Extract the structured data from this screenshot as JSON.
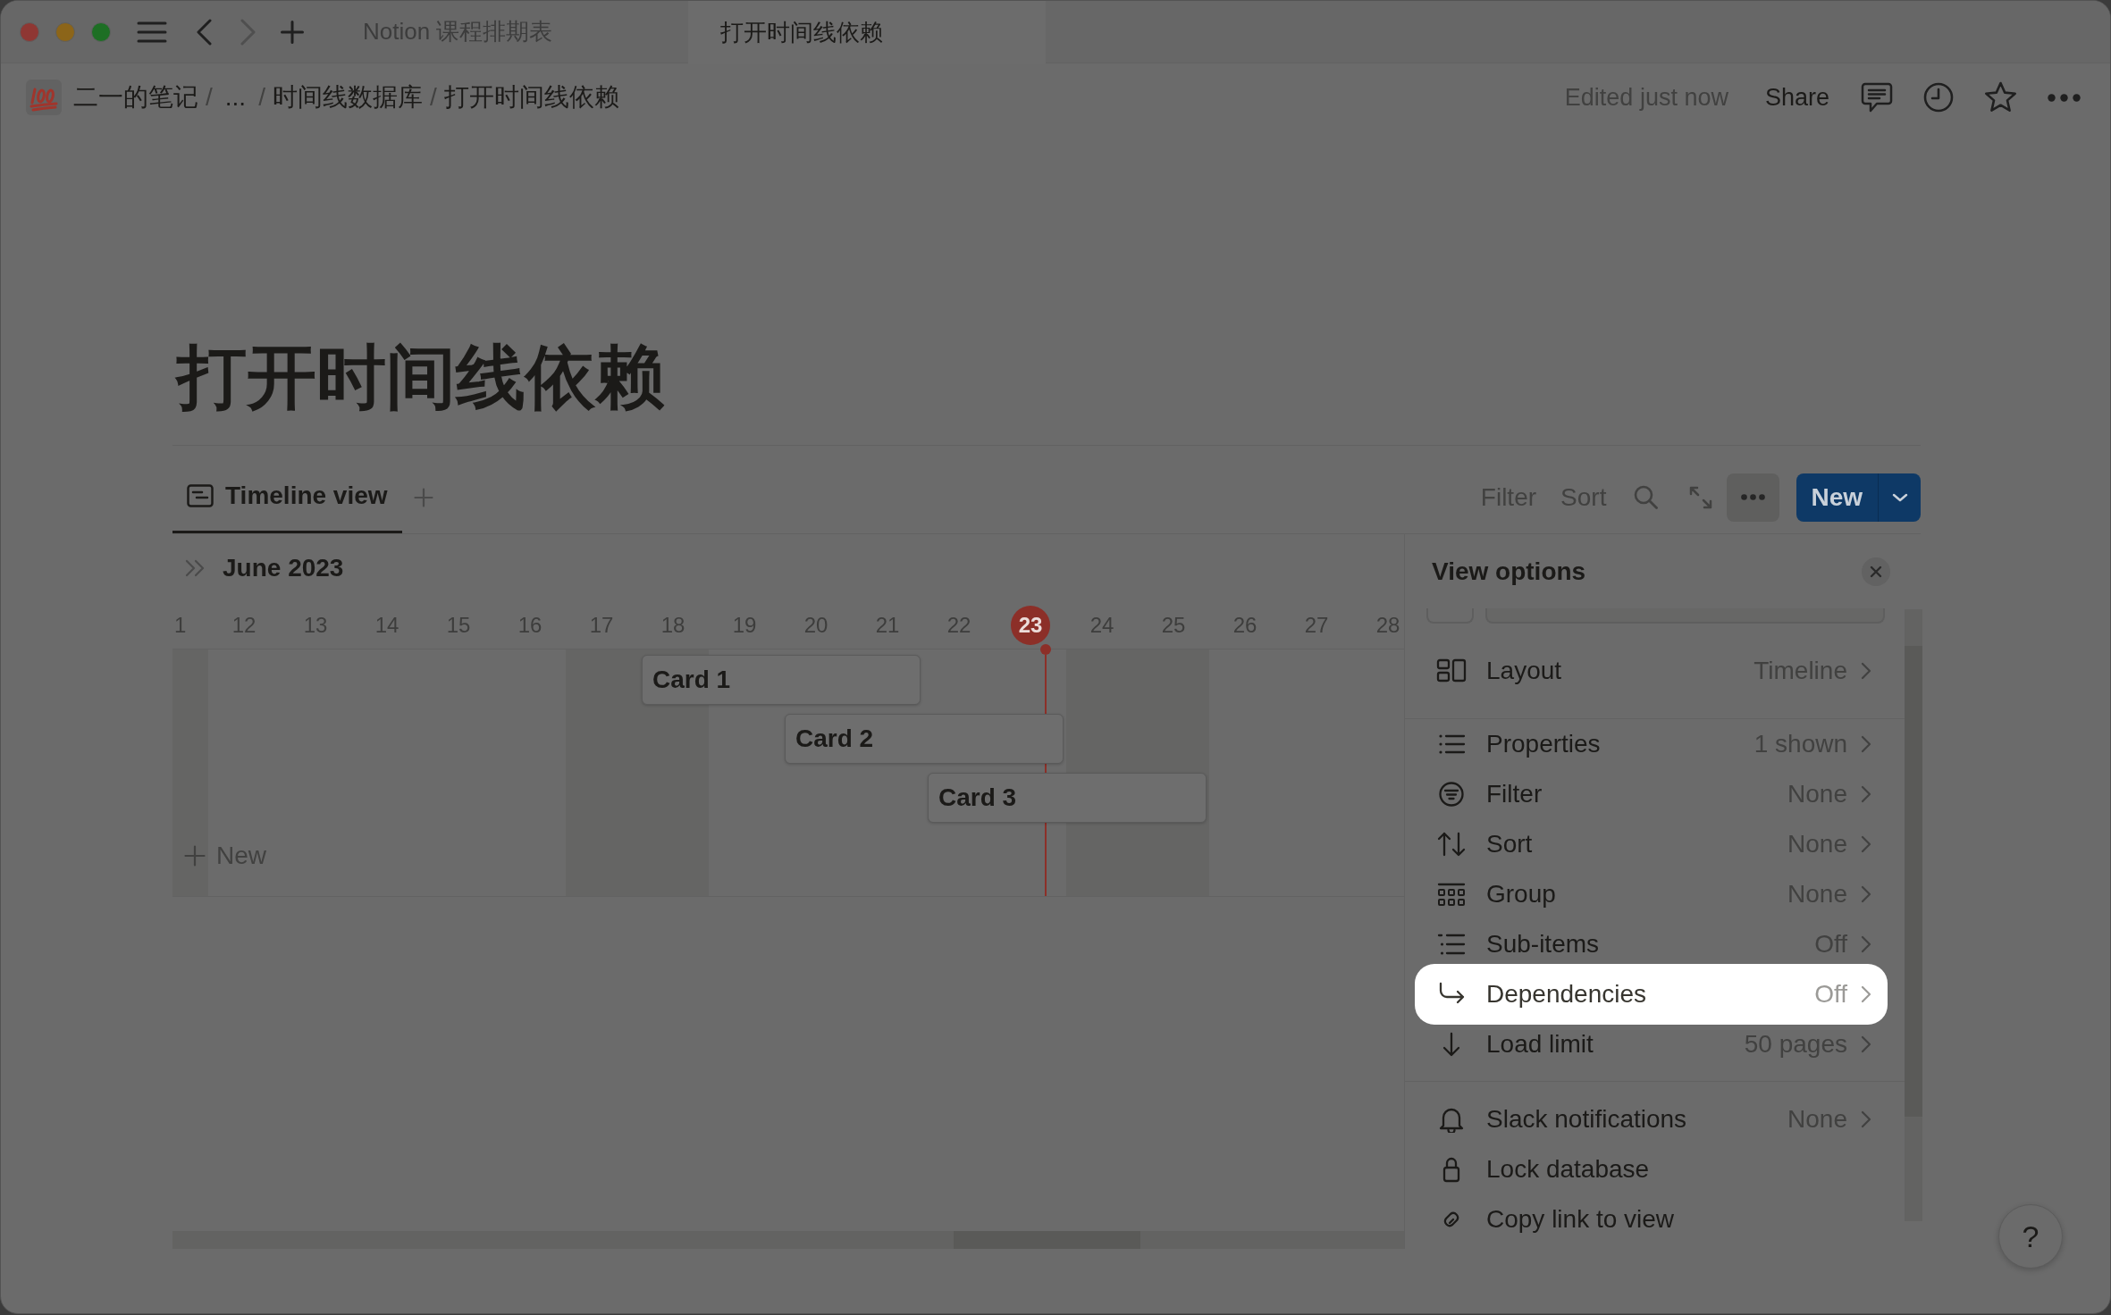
{
  "titlebar": {
    "back_disabled": false,
    "forward_disabled": true,
    "tabs": [
      {
        "title": "Notion 课程排期表",
        "selected": false
      },
      {
        "title": "打开时间线依赖",
        "selected": true
      }
    ]
  },
  "breadcrumb": {
    "separator": "/",
    "items": [
      "二一的笔记",
      "...",
      "时间线数据库",
      "打开时间线依赖"
    ]
  },
  "topbar": {
    "edited": "Edited just now",
    "share": "Share"
  },
  "page": {
    "title": "打开时间线依赖"
  },
  "view_tabs": [
    {
      "label": "Timeline view",
      "selected": true
    }
  ],
  "toolbar": {
    "filter": "Filter",
    "sort": "Sort",
    "more_active": true,
    "new": "New"
  },
  "timeline": {
    "month": "June 2023",
    "dates": [
      {
        "label": "1",
        "weekend": true,
        "today": false
      },
      {
        "label": "12",
        "weekend": false,
        "today": false
      },
      {
        "label": "13",
        "weekend": false,
        "today": false
      },
      {
        "label": "14",
        "weekend": false,
        "today": false
      },
      {
        "label": "15",
        "weekend": false,
        "today": false
      },
      {
        "label": "16",
        "weekend": false,
        "today": false
      },
      {
        "label": "17",
        "weekend": true,
        "today": false
      },
      {
        "label": "18",
        "weekend": true,
        "today": false
      },
      {
        "label": "19",
        "weekend": false,
        "today": false
      },
      {
        "label": "20",
        "weekend": false,
        "today": false
      },
      {
        "label": "21",
        "weekend": false,
        "today": false
      },
      {
        "label": "22",
        "weekend": false,
        "today": false
      },
      {
        "label": "23",
        "weekend": false,
        "today": true
      },
      {
        "label": "24",
        "weekend": true,
        "today": false
      },
      {
        "label": "25",
        "weekend": true,
        "today": false
      },
      {
        "label": "26",
        "weekend": false,
        "today": false
      },
      {
        "label": "27",
        "weekend": false,
        "today": false
      },
      {
        "label": "28",
        "weekend": false,
        "today": false
      }
    ],
    "cards": [
      {
        "title": "Card 1"
      },
      {
        "title": "Card 2"
      },
      {
        "title": "Card 3"
      }
    ],
    "new": "New"
  },
  "view_options": {
    "title": "View options",
    "sections": [
      {
        "items": [
          {
            "label": "Layout",
            "value": "Timeline",
            "highlighted": false
          }
        ]
      },
      {
        "items": [
          {
            "label": "Properties",
            "value": "1 shown",
            "highlighted": false
          },
          {
            "label": "Filter",
            "value": "None",
            "highlighted": false
          },
          {
            "label": "Sort",
            "value": "None",
            "highlighted": false
          },
          {
            "label": "Group",
            "value": "None",
            "highlighted": false
          },
          {
            "label": "Sub-items",
            "value": "Off",
            "highlighted": false
          },
          {
            "label": "Dependencies",
            "value": "Off",
            "highlighted": true
          },
          {
            "label": "Load limit",
            "value": "50 pages",
            "highlighted": false
          }
        ]
      },
      {
        "items": [
          {
            "label": "Slack notifications",
            "value": "None",
            "highlighted": false
          },
          {
            "label": "Lock database",
            "highlighted": false
          },
          {
            "label": "Copy link to view",
            "highlighted": false
          }
        ]
      }
    ]
  },
  "help": "?"
}
